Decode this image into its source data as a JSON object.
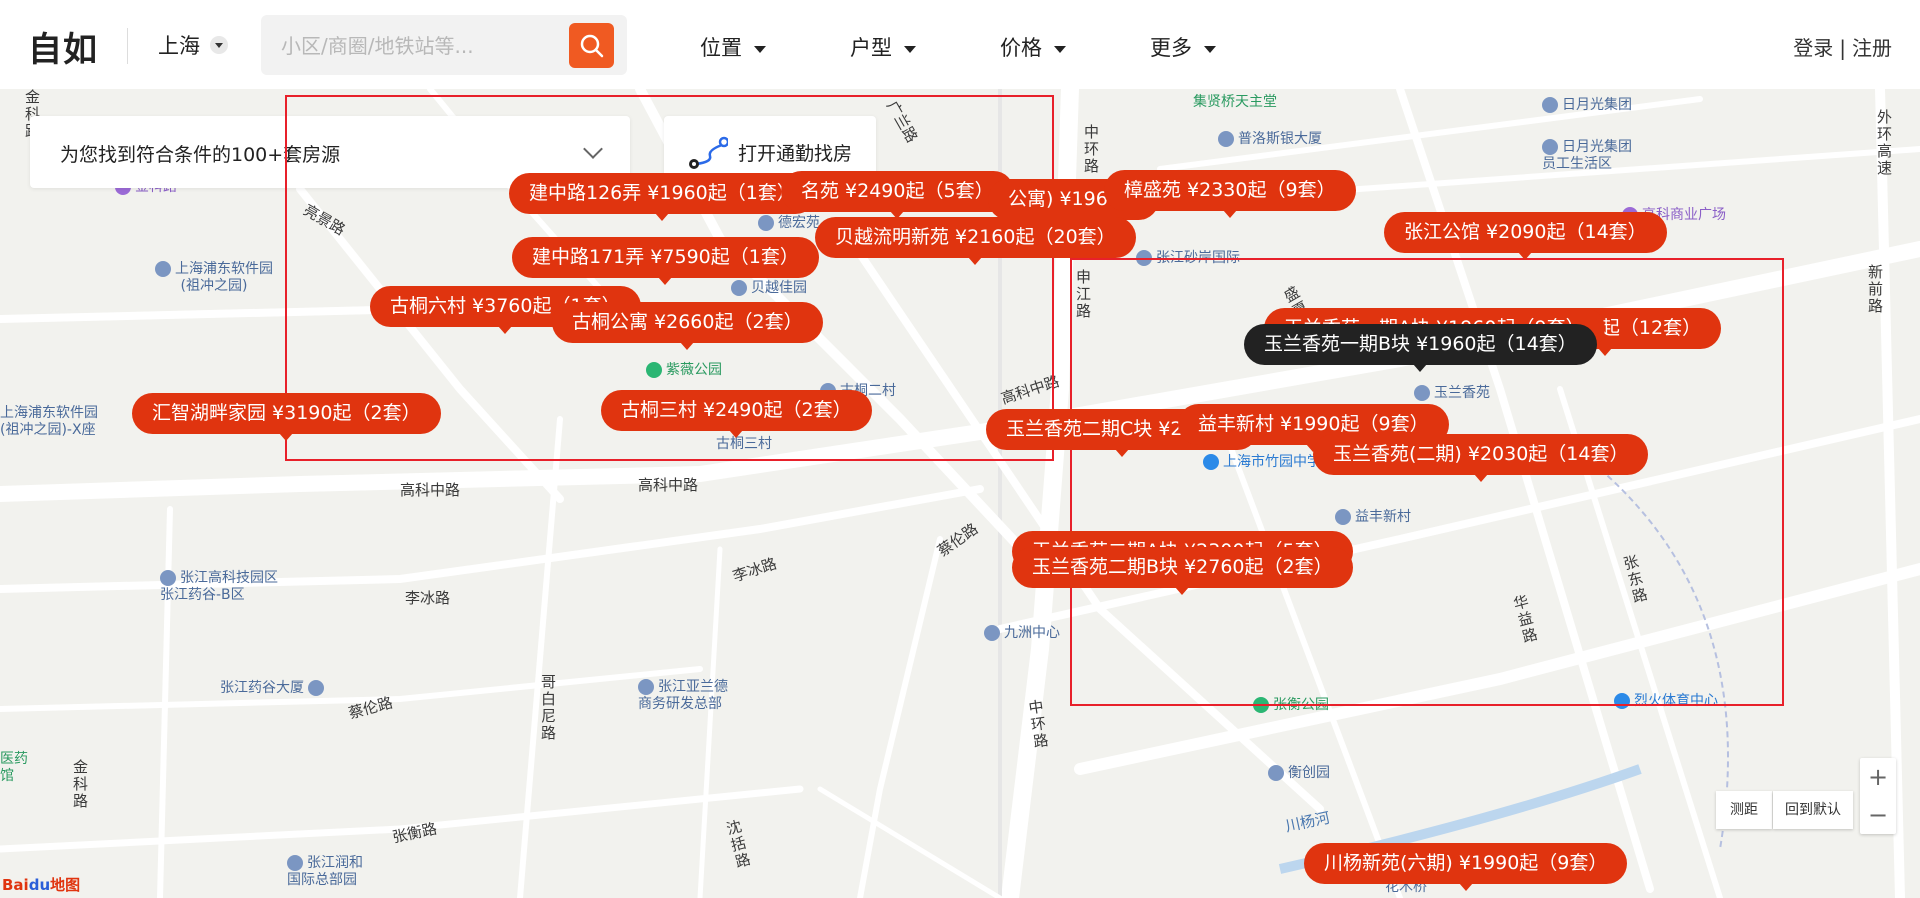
{
  "app": {
    "logo": "自如"
  },
  "header": {
    "city": "上海",
    "search": {
      "placeholder": "小区/商圈/地铁站等...",
      "value": ""
    },
    "nav": [
      "位置",
      "户型",
      "价格",
      "更多"
    ],
    "auth": {
      "login": "登录",
      "separator": "|",
      "register": "注册"
    }
  },
  "map": {
    "result_summary": "为您找到符合条件的100+套房源",
    "commute_label": "打开通勤找房",
    "listings": [
      {
        "text": "建中路126弄 ¥1960起（1套）"
      },
      {
        "text": "名苑 ¥2490起（5套）"
      },
      {
        "text": "公寓) ¥1960起"
      },
      {
        "text": "樟盛苑 ¥2330起（9套）"
      },
      {
        "text": "贝越流明新苑 ¥2160起（20套）"
      },
      {
        "text": "张江公馆 ¥2090起（14套）"
      },
      {
        "text": "建中路171弄 ¥7590起（1套）"
      },
      {
        "text": "古桐六村 ¥3760起（1套）"
      },
      {
        "text": "古桐公寓 ¥2660起（2套）"
      },
      {
        "text": "期) ¥1960起（12套）"
      },
      {
        "text": "玉兰香苑一期A块 ¥1960起（9套）"
      },
      {
        "text": "玉兰香苑一期B块 ¥1960起（14套）"
      },
      {
        "text": "汇智湖畔家园 ¥3190起（2套）"
      },
      {
        "text": "古桐三村 ¥2490起（2套）"
      },
      {
        "text": "玉兰香苑二期C块 ¥2000起"
      },
      {
        "text": "益丰新村 ¥1990起（9套）"
      },
      {
        "text": "玉兰香苑(二期) ¥2030起（14套）"
      },
      {
        "text": "玉兰香苑二期A块 ¥2300起（5套）"
      },
      {
        "text": "玉兰香苑二期B块 ¥2760起（2套）"
      },
      {
        "text": "川杨新苑(六期) ¥1990起（9套）"
      }
    ],
    "roads": [
      "亮景路",
      "广兰路",
      "中环路",
      "申江路",
      "高科中路",
      "高科中路",
      "高科中路",
      "李冰路",
      "李冰路",
      "蔡伦路",
      "蔡伦路",
      "哥白尼路",
      "中环路",
      "金科路",
      "张衡路",
      "沈括路",
      "盛夏路",
      "张东路",
      "华益路",
      "外环高速",
      "新前路",
      "川杨河",
      "金科路"
    ],
    "pois": [
      {
        "text": "集贤桥天主堂",
        "style": "green"
      },
      {
        "text": "普洛斯银大厦",
        "style": "default"
      },
      {
        "text": "日月光集团",
        "style": "default"
      },
      {
        "text": "日月光集团\n员工生活区",
        "style": "default"
      },
      {
        "text": "高科商业广场",
        "style": "purple"
      },
      {
        "text": "张江砂岸国际",
        "style": "default"
      },
      {
        "text": "上海浦东软件园\n(祖冲之园)",
        "style": "default"
      },
      {
        "text": "德宏苑",
        "style": "default"
      },
      {
        "text": "贝越佳园",
        "style": "default"
      },
      {
        "text": "紫薇公园",
        "style": "green"
      },
      {
        "text": "古桐二村",
        "style": "default"
      },
      {
        "text": "古桐三村",
        "style": "default"
      },
      {
        "text": "上海浦东软件园\n(祖冲之园)-X座",
        "style": "default"
      },
      {
        "text": "玉兰香苑",
        "style": "default"
      },
      {
        "text": "上海市竹园中学",
        "style": "blue"
      },
      {
        "text": "益丰新村",
        "style": "default"
      },
      {
        "text": "张江高科技园区\n张江药谷-B区",
        "style": "default"
      },
      {
        "text": "九洲中心",
        "style": "default"
      },
      {
        "text": "张江药谷大厦",
        "style": "default"
      },
      {
        "text": "张江亚兰德\n商务研发总部",
        "style": "default"
      },
      {
        "text": "张衡公园",
        "style": "green"
      },
      {
        "text": "烈火体育中心",
        "style": "blue"
      },
      {
        "text": "衡创园",
        "style": "default"
      },
      {
        "text": "张江润和\n国际总部园",
        "style": "default"
      },
      {
        "text": "金科路",
        "style": "purple"
      },
      {
        "text": "花木桥",
        "style": "default"
      },
      {
        "text": "医药\n馆",
        "style": "green"
      }
    ],
    "tools": {
      "measure": "测距",
      "reset": "回到默认",
      "zoom_in": "+",
      "zoom_out": "−"
    },
    "attribution": {
      "brand_a": "Bai",
      "brand_b": "du",
      "suffix": "地图"
    }
  },
  "colors": {
    "accent": "#e0340f",
    "search_button": "#f05a22",
    "selection_box": "#e8202a",
    "active_label": "#222222"
  }
}
